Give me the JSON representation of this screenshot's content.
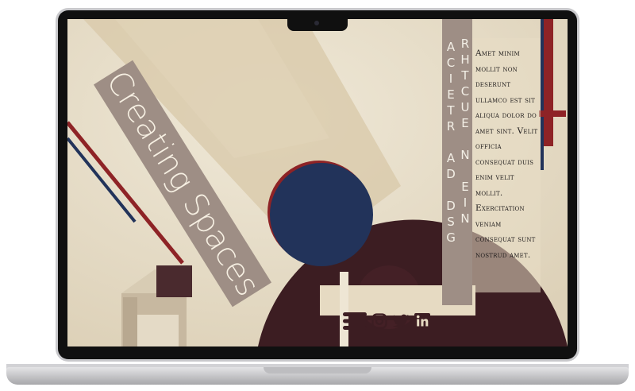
{
  "site": {
    "title": "Creating Spaces",
    "vertical_title": {
      "col1": "ACIETR AD DSG",
      "col2": "RHTCUE N EIN"
    },
    "paragraph": "Amet minim mollit non deserunt ullamco est sit aliqua dolor do amet sint. Velit officia consequat duis enim velit mollit. Exercitation veniam consequat sunt nostrud amet."
  },
  "icons": {
    "menu": "menu-icon",
    "instagram": "instagram-icon",
    "twitter": "twitter-icon",
    "linkedin": "linkedin-icon"
  },
  "colors": {
    "navy": "#22335a",
    "maroon": "#3c1d22",
    "red": "#8e2326",
    "taupe": "#9e8e85",
    "cream": "#e8dfcb"
  }
}
